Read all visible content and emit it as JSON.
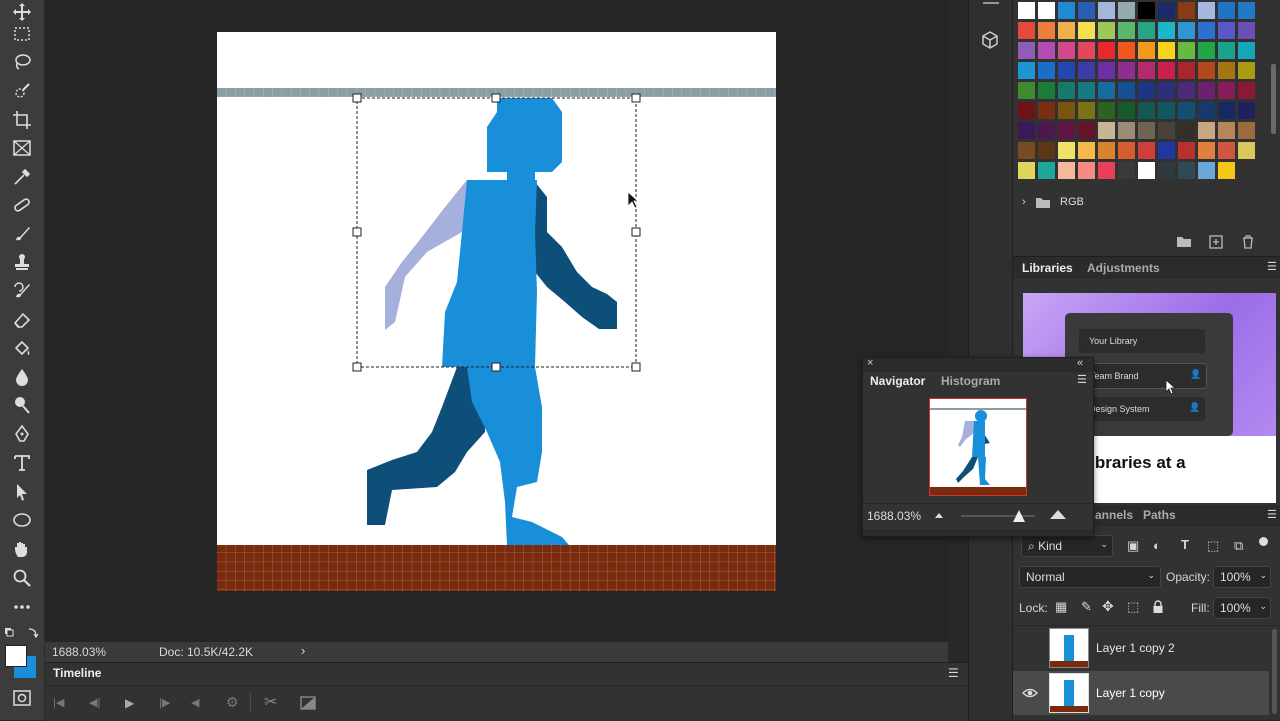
{
  "status_bar": {
    "zoom": "1688.03%",
    "doc_size": "Doc: 10.5K/42.2K"
  },
  "timeline": {
    "title": "Timeline"
  },
  "swatches": {
    "group_label": "RGB",
    "colors": [
      "#ffffff",
      "#ffffff",
      "#1e8ad6",
      "#2a5db3",
      "#a5b6dd",
      "#95aab0",
      "#000000",
      "#1a2a6c",
      "#8a3a14",
      "#a7b7de",
      "#1d74c5",
      "#1f79c6",
      "#e44a3b",
      "#ec7d3a",
      "#f0b14b",
      "#f4e04d",
      "#9dc856",
      "#5bb66e",
      "#26a586",
      "#1bb7c9",
      "#2f96d6",
      "#2d6fd0",
      "#5a57c8",
      "#6c4fb6",
      "#8f5db5",
      "#b44db0",
      "#d6488c",
      "#e2475b",
      "#e8282f",
      "#f2561f",
      "#f39a1c",
      "#f7d41a",
      "#68b93f",
      "#22a549",
      "#19a38d",
      "#15a7b7",
      "#1b96d3",
      "#1a6ec6",
      "#2347b0",
      "#3d3ba7",
      "#6d2fa3",
      "#8f2e8f",
      "#b52a6e",
      "#c9214a",
      "#a9262a",
      "#b4481d",
      "#a77414",
      "#a89d12",
      "#3f8a2e",
      "#1b7c3a",
      "#157a6b",
      "#137a83",
      "#166c9e",
      "#174f93",
      "#1b3783",
      "#2c2f80",
      "#4e2879",
      "#6b2170",
      "#871c59",
      "#8a1938",
      "#6e1418",
      "#7a2f15",
      "#7a5512",
      "#7a7214",
      "#2d6320",
      "#175b2a",
      "#125a4f",
      "#12585f",
      "#134f72",
      "#153a6b",
      "#172962",
      "#211f5d",
      "#391a58",
      "#4e1752",
      "#621542",
      "#661529",
      "#c8b593",
      "#9a8b73",
      "#6f6454",
      "#4a4239",
      "#343029",
      "#c7a780",
      "#b48758",
      "#9a6b3e",
      "#7a4b22",
      "#5b3718",
      "#f0e169",
      "#f5b84a",
      "#d9842c",
      "#d55d2e",
      "#cc3f3a",
      "#2136a0",
      "#b7322d",
      "#e07f3f",
      "#d0573d",
      "#d9c85a",
      "#e0d65b",
      "#1ba79a",
      "#f6b89a",
      "#f48a80",
      "#e8405a",
      "#3a3a3a",
      "#ffffff",
      "#2e3a3f",
      "#2f4a55",
      "#6aa7d6",
      "#f5c518"
    ]
  },
  "libraries": {
    "tabs": [
      "Libraries",
      "Adjustments"
    ],
    "promo_items": [
      "Your Library",
      "Team Brand",
      "Design System"
    ],
    "promo_headline": "All libraries at a"
  },
  "navigator": {
    "tabs": [
      "Navigator",
      "Histogram"
    ],
    "zoom": "1688.03%",
    "slider_fraction": 0.78
  },
  "layers": {
    "tabs": [
      "Channels",
      "Paths"
    ],
    "filter_kind": "Kind",
    "blend_mode": "Normal",
    "opacity_label": "Opacity:",
    "opacity_value": "100%",
    "lock_label": "Lock:",
    "fill_label": "Fill:",
    "fill_value": "100%",
    "items": [
      {
        "name": "Layer 1 copy 2",
        "visible": false
      },
      {
        "name": "Layer 1 copy",
        "visible": true
      }
    ]
  },
  "colors": {
    "accent": "#1473e6",
    "figure_main": "#1a8fd9",
    "figure_light": "#a6b0dc",
    "figure_dark": "#0d4f78",
    "ground": "#7a2b0e",
    "ceiling": "#8a9ea4"
  }
}
